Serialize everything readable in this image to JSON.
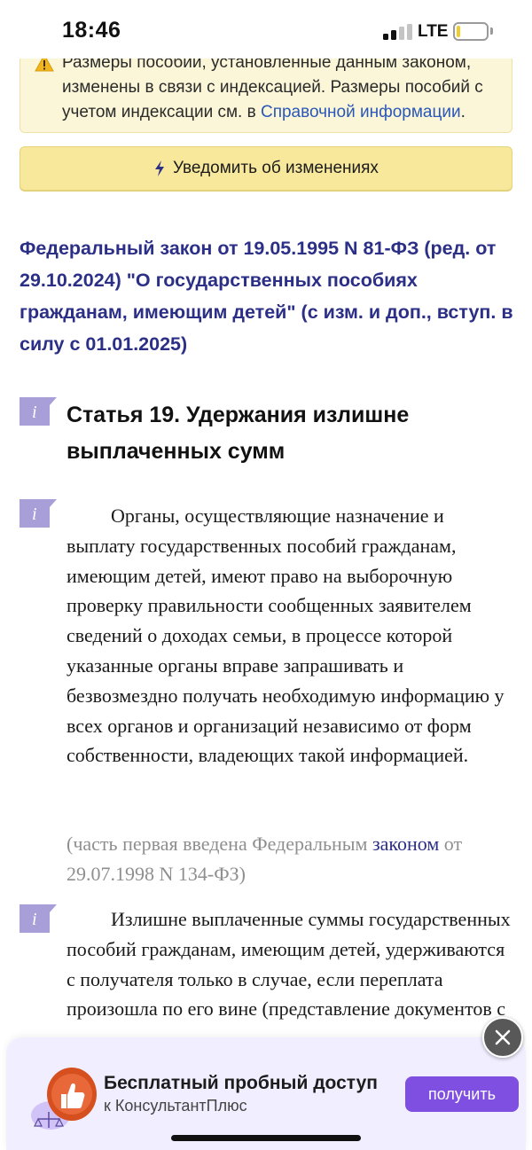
{
  "status_bar": {
    "time": "18:46",
    "network": "LTE"
  },
  "notice": {
    "text": "Размеры пособий, установленные данным законом, изменены в связи с индексацией. Размеры пособий с учетом индексации см. в ",
    "link": "Справочной информации",
    "end": "."
  },
  "notify_button": {
    "label": "Уведомить об изменениях"
  },
  "law_title": "Федеральный закон от 19.05.1995 N 81-ФЗ (ред. от 29.10.2024) \"О государственных пособиях гражданам, имеющим детей\" (с изм. и доп., вступ. в силу с 01.01.2025)",
  "article": {
    "title": "Статья 19. Удержания излишне выплаченных сумм",
    "paragraph1": "Органы, осуществляющие назначение и выплату государственных пособий гражданам, имеющим детей, имеют право на выборочную проверку правильности сообщенных заявителем сведений о доходах семьи, в процессе которой указанные органы вправе запрашивать и безвозмездно получать необходимую информацию у всех органов и организаций независимо от форм собственности, владеющих такой информацией.",
    "note_prefix": "(часть первая введена Федеральным ",
    "note_link": "законом",
    "note_suffix": " от 29.07.1998 N 134-ФЗ)",
    "paragraph2": "Излишне выплаченные суммы государственных пособий гражданам, имеющим детей, удерживаются с получателя только в случае, если переплата произошла по его вине (представление документов с"
  },
  "promo": {
    "title": "Бесплатный пробный доступ",
    "subtitle": "к КонсультантПлюс",
    "button": "получить"
  },
  "colors": {
    "link_dark": "#2b2f86",
    "link_blue": "#2a57b8",
    "notice_bg": "#fbf6d8",
    "button_yellow": "#f8e89c",
    "promo_button": "#7e4fe0",
    "info_icon": "#a89fd8"
  },
  "icons": {
    "warning": "warning-triangle-icon",
    "notify": "lightning-bolt-icon",
    "info": "info-flag-icon",
    "close": "close-icon",
    "promo_logo": "consultant-thumb-logo-icon"
  }
}
